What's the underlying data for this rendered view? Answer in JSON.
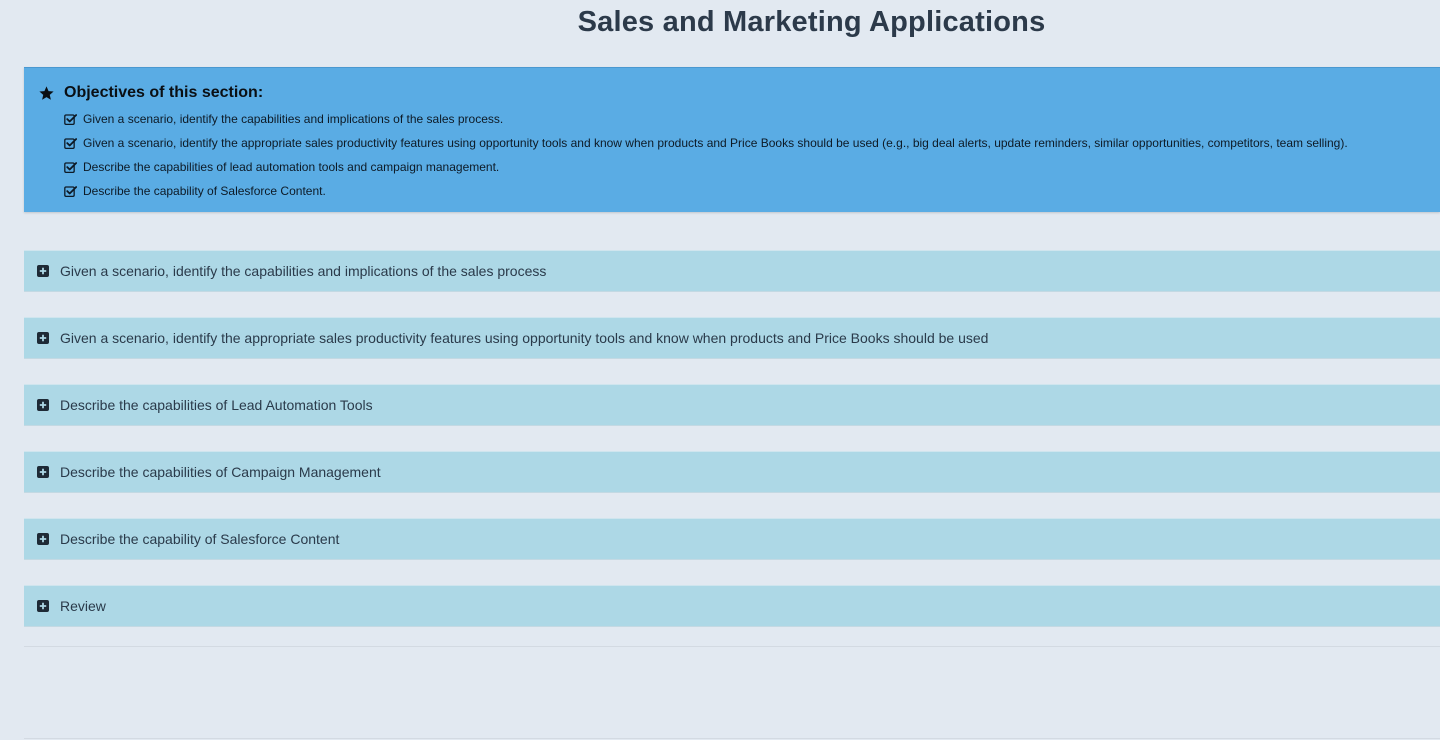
{
  "page": {
    "title": "Sales and Marketing Applications"
  },
  "objectives": {
    "title": "Objectives of this section:",
    "items": [
      "Given a scenario, identify the capabilities and implications of the sales process.",
      "Given a scenario, identify the appropriate sales productivity features using opportunity tools and know when products and Price Books should be used (e.g., big deal alerts, update reminders, similar opportunities, competitors, team selling).",
      "Describe the capabilities of lead automation tools and campaign management.",
      "Describe the capability of Salesforce Content."
    ],
    "icon": "star-icon",
    "item_icon": "check-square-icon"
  },
  "accordion": {
    "icon": "plus-square-icon",
    "items": [
      "Given a scenario, identify the capabilities and implications of the sales process",
      "Given a scenario, identify the appropriate sales productivity features using opportunity tools and know when products and Price Books should be used",
      "Describe the capabilities of Lead Automation Tools",
      "Describe the capabilities of Campaign Management",
      "Describe the capability of Salesforce Content",
      "Review"
    ]
  },
  "colors": {
    "background": "#e2e9f1",
    "objectives_bg": "#5aace4",
    "accordion_bg": "#add8e6",
    "title_text": "#2c3a4a"
  }
}
